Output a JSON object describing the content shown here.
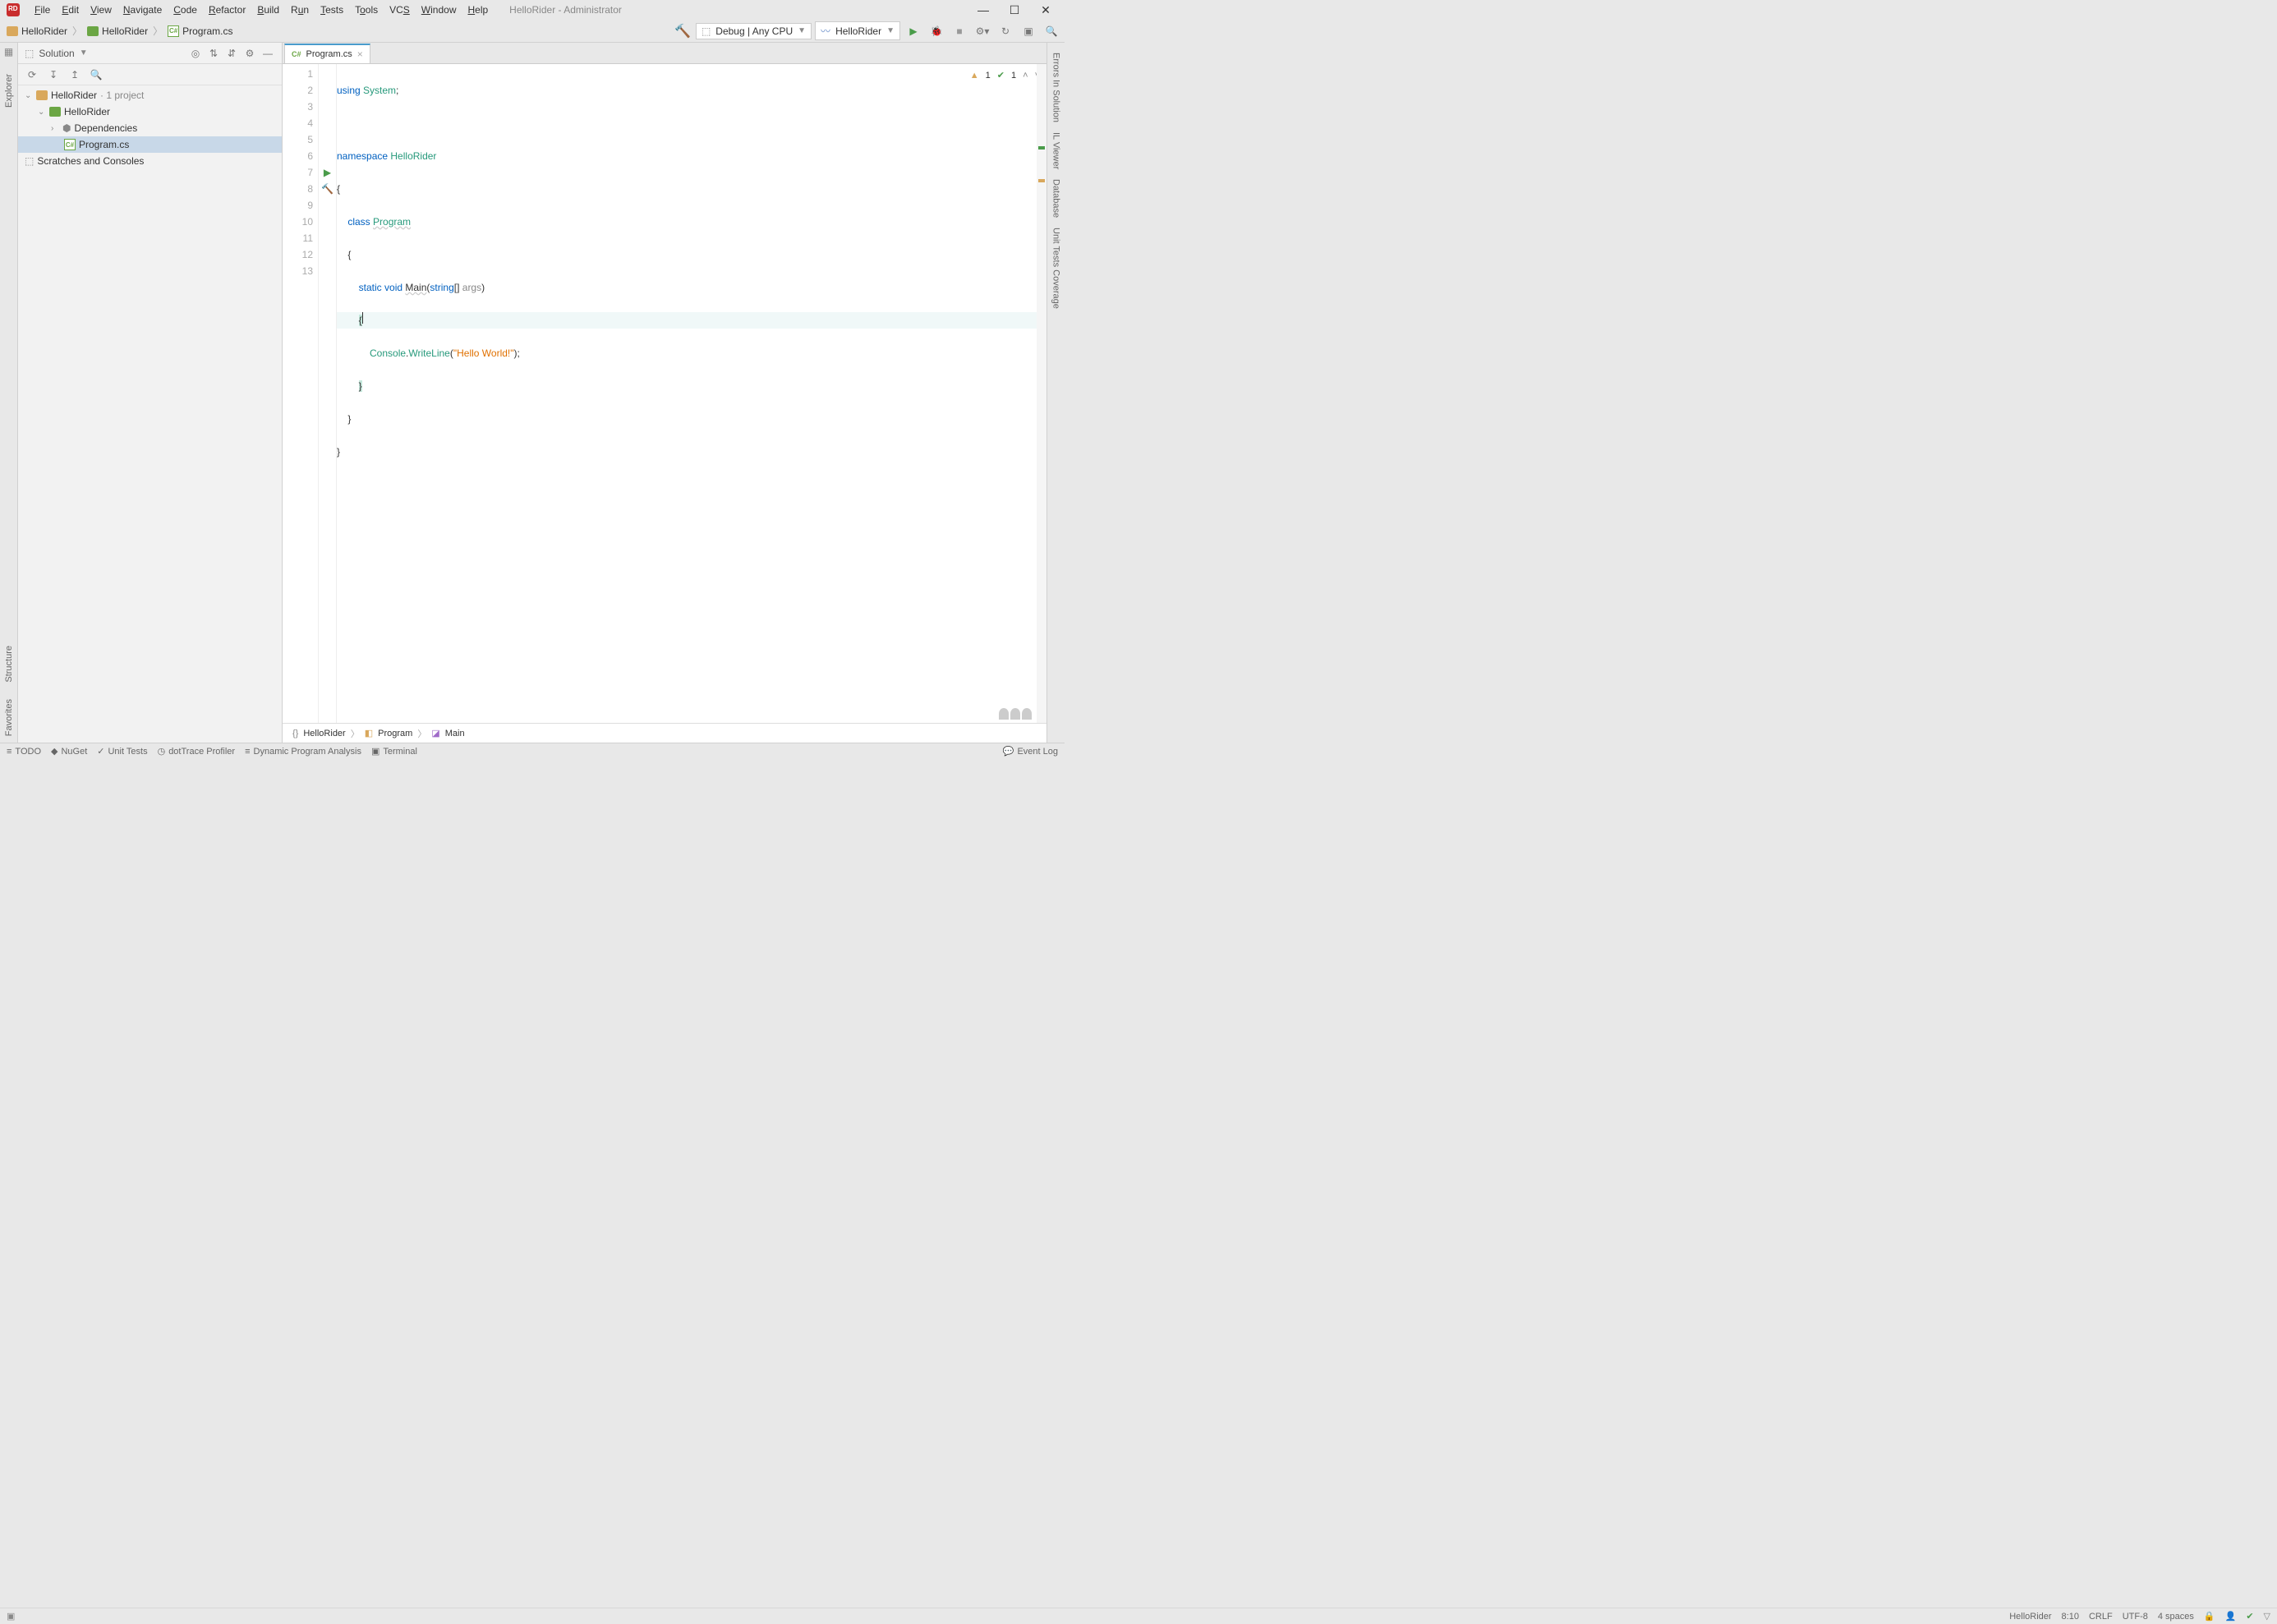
{
  "window": {
    "title": "HelloRider - Administrator"
  },
  "menu": [
    "File",
    "Edit",
    "View",
    "Navigate",
    "Code",
    "Refactor",
    "Build",
    "Run",
    "Tests",
    "Tools",
    "VCS",
    "Window",
    "Help"
  ],
  "breadcrumb": {
    "items": [
      "HelloRider",
      "HelloRider",
      "Program.cs"
    ]
  },
  "toolbar": {
    "config": "Debug | Any CPU",
    "run_target": "HelloRider"
  },
  "solution": {
    "title": "Solution",
    "root": "HelloRider",
    "root_suffix": "· 1 project",
    "project": "HelloRider",
    "deps": "Dependencies",
    "file": "Program.cs",
    "scratches": "Scratches and Consoles"
  },
  "tab": {
    "label": "Program.cs",
    "prefix": "C#"
  },
  "warnings": {
    "warn": "1",
    "ok": "1"
  },
  "code": {
    "lines": 13,
    "l1_using": "using",
    "l1_sys": "System",
    "l1_semi": ";",
    "l3_ns": "namespace",
    "l3_name": "HelloRider",
    "l4_brace": "{",
    "l5_class": "class",
    "l5_name": "Program",
    "l6_brace": "{",
    "l7_static": "static",
    "l7_void": "void",
    "l7_main": "Main",
    "l7_string": "string",
    "l7_brackets": "[]",
    "l7_args": "args",
    "l8_brace": "{",
    "l9_console": "Console",
    "l9_dot": ".",
    "l9_write": "WriteLine",
    "l9_str": "\"Hello World!\"",
    "l10_brace": "}",
    "l11_brace": "}",
    "l12_brace": "}"
  },
  "bottom_breadcrumb": [
    "HelloRider",
    "Program",
    "Main"
  ],
  "bottom_tools": [
    "TODO",
    "NuGet",
    "Unit Tests",
    "dotTrace Profiler",
    "Dynamic Program Analysis",
    "Terminal"
  ],
  "status": {
    "event_log": "Event Log",
    "project": "HelloRider",
    "pos": "8:10",
    "eol": "CRLF",
    "enc": "UTF-8",
    "indent": "4 spaces"
  },
  "left_strips": [
    "Explorer"
  ],
  "left_strips2": [
    "Structure",
    "Favorites"
  ],
  "right_strips": [
    "Errors In Solution",
    "IL Viewer",
    "Database",
    "Unit Tests Coverage"
  ]
}
